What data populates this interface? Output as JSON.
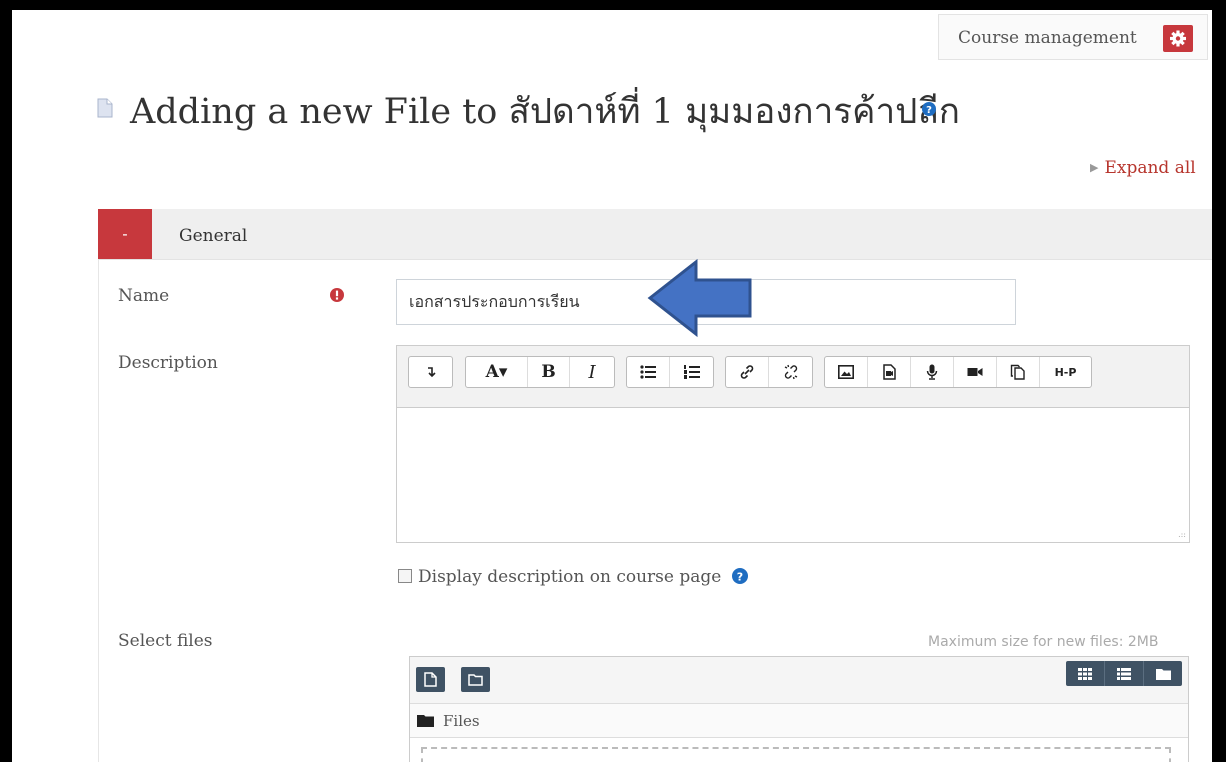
{
  "header": {
    "course_management_label": "Course management",
    "settings_icon": "gear-icon",
    "title": "Adding a new File to สัปดาห์ที่ 1 มุมมองการค้าปลีก",
    "expand_all_label": "Expand all"
  },
  "section": {
    "toggle_label": "-",
    "legend": "General"
  },
  "form": {
    "name_label": "Name",
    "name_value": "เอกสารประกอบการเรียน",
    "description_label": "Description",
    "display_description_label": "Display description on course page",
    "select_files_label": "Select files",
    "max_size_text": "Maximum size for new files: 2MB",
    "files_path_label": "Files"
  },
  "editor_toolbar": {
    "bold": "B",
    "italic": "I",
    "font_size": "A▾",
    "h5p": "H-P"
  },
  "colors": {
    "accent_red": "#c7383d",
    "link_red": "#b7352d",
    "help_blue": "#1f6dc1",
    "filepicker_btn": "#3f5264",
    "arrow_blue": "#4472c4"
  }
}
